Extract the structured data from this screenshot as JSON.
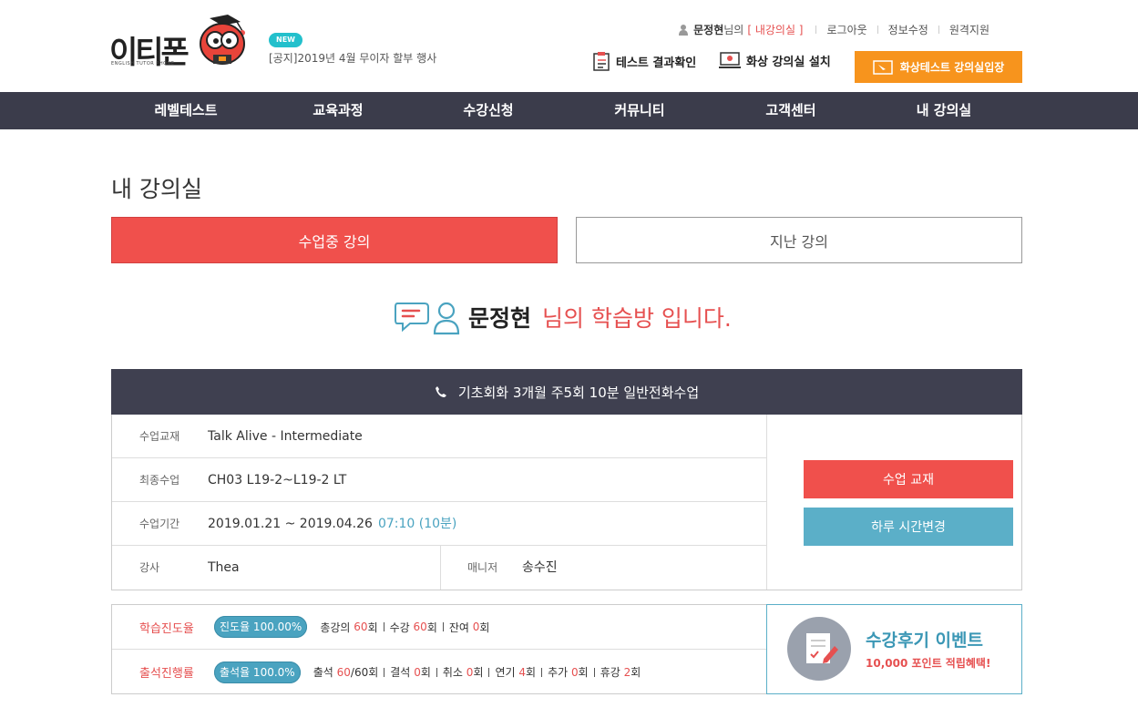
{
  "header": {
    "logo_text": "이티폰",
    "logo_sub": "ENGLISH TUTOR PHONE",
    "new_badge": "NEW",
    "notice": "[공지]2019년 4월 무이자 할부 행사",
    "user_name": "문정현",
    "user_suffix": "님의",
    "my_room_link": "[ 내강의실 ]",
    "links": [
      "로그아웃",
      "정보수정",
      "원격지원"
    ],
    "quick_test_result": "테스트 결과확인",
    "quick_install": "화상 강의실 설치",
    "video_test_button": "화상테스트 강의실입장"
  },
  "nav": [
    "레벨테스트",
    "교육과정",
    "수강신청",
    "커뮤니티",
    "고객센터",
    "내 강의실"
  ],
  "page_title": "내 강의실",
  "tabs": {
    "active": "수업중 강의",
    "inactive": "지난 강의"
  },
  "greeting": {
    "name": "문정현",
    "rest": "님의 학습방 입니다."
  },
  "course": {
    "title": "기초회화 3개월 주5회 10분 일반전화수업",
    "rows": [
      {
        "label": "수업교재",
        "value": "Talk Alive - Intermediate"
      },
      {
        "label": "최종수업",
        "value": "CH03 L19-2~L19-2 LT"
      },
      {
        "label": "수업기간",
        "value": "2019.01.21 ~ 2019.04.26",
        "time": "07:10 (10분)"
      }
    ],
    "teacher_label": "강사",
    "teacher": "Thea",
    "manager_label": "매니저",
    "manager": "송수진",
    "btn_book": "수업 교재",
    "btn_time": "하루 시간변경"
  },
  "progress": {
    "study_label": "학습진도율",
    "study_pill": "진도율 100.00%",
    "total_label": "총강의",
    "total": "60",
    "total_unit": "회",
    "taken_label": "수강",
    "taken": "60",
    "taken_unit": "회",
    "remain_label": "잔여",
    "remain": "0",
    "remain_unit": "회",
    "attend_label": "출석진행률",
    "attend_pill": "출석율 100.0%",
    "att_label": "출석",
    "att": "60",
    "att_total": "/60회",
    "absent_label": "결석",
    "absent": "0",
    "absent_unit": "회",
    "cancel_label": "취소",
    "cancel": "0",
    "cancel_unit": "회",
    "delay_label": "연기",
    "delay": "4",
    "delay_unit": "회",
    "extra_label": "추가",
    "extra": "0",
    "extra_unit": "회",
    "rest_label": "휴강",
    "rest": "2",
    "rest_unit": "회"
  },
  "event": {
    "title": "수강후기 이벤트",
    "subtitle": "10,000 포인트 적립혜택!"
  }
}
